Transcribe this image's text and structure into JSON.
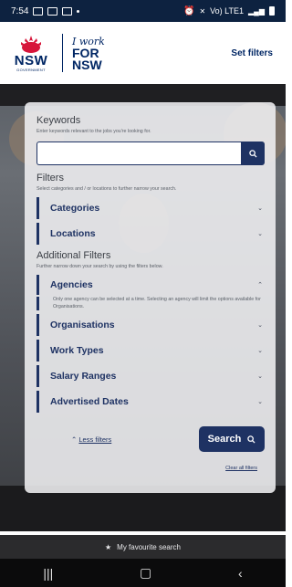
{
  "status_bar": {
    "time": "7:54",
    "network_text": "Vo) LTE1"
  },
  "header": {
    "logo_nsw": "NSW",
    "logo_gov": "GOVERNMENT",
    "work_script": "I work",
    "work_for": "FOR",
    "work_nsw": "NSW",
    "set_filters": "Set filters"
  },
  "keywords": {
    "title": "Keywords",
    "subtitle": "Enter keywords relevant to the jobs you're looking for.",
    "placeholder": "",
    "value": ""
  },
  "filters": {
    "title": "Filters",
    "subtitle": "Select categories and / or locations to further narrow your search.",
    "items": [
      {
        "label": "Categories"
      },
      {
        "label": "Locations"
      }
    ]
  },
  "additional_filters": {
    "title": "Additional Filters",
    "subtitle": "Further narrow down your search by using the filters below.",
    "agencies": {
      "label": "Agencies",
      "desc": "Only one agency can be selected at a time. Selecting an agency will limit the options available for Organisations."
    },
    "items": [
      {
        "label": "Organisations"
      },
      {
        "label": "Work Types"
      },
      {
        "label": "Salary Ranges"
      },
      {
        "label": "Advertised Dates"
      }
    ]
  },
  "actions": {
    "less_filters": "Less filters",
    "search": "Search",
    "clear_all": "Clear all filters"
  },
  "footer": {
    "favourite": "My favourite search"
  },
  "colors": {
    "navy": "#1e3263",
    "nsw_red": "#d7153a"
  }
}
